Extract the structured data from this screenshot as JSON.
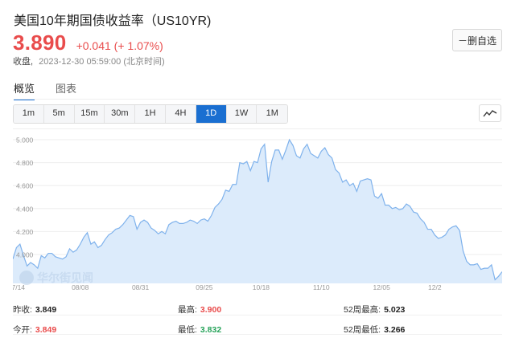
{
  "header": {
    "title": "美国10年期国债收益率（US10YR)",
    "price": "3.890",
    "change": "+0.041 (+ 1.07%)",
    "status_label": "收盘,",
    "status_time": "2023-12-30 05:59:00 (北京时间)",
    "fav_label": "－删自选"
  },
  "tabs": [
    {
      "label": "概览",
      "active": true
    },
    {
      "label": "图表",
      "active": false
    }
  ],
  "periods": [
    {
      "label": "1m"
    },
    {
      "label": "5m"
    },
    {
      "label": "15m"
    },
    {
      "label": "30m"
    },
    {
      "label": "1H"
    },
    {
      "label": "4H"
    },
    {
      "label": "1D",
      "active": true
    },
    {
      "label": "1W"
    },
    {
      "label": "1M"
    }
  ],
  "watermark": "华尔街见闻",
  "chart_data": {
    "type": "area",
    "ylim": [
      3.8,
      5.0
    ],
    "y_ticks": [
      "5.000",
      "4.800",
      "4.600",
      "4.400",
      "4.200",
      "4.000"
    ],
    "x_ticks": [
      {
        "label": "07/14",
        "i": 1
      },
      {
        "label": "08/08",
        "i": 19
      },
      {
        "label": "08/31",
        "i": 36
      },
      {
        "label": "09/25",
        "i": 54
      },
      {
        "label": "10/18",
        "i": 70
      },
      {
        "label": "11/10",
        "i": 87
      },
      {
        "label": "12/05",
        "i": 104
      },
      {
        "label": "12/2",
        "i": 119
      }
    ],
    "series": [
      {
        "color": "#7fb2ec",
        "fill": "#dcebfb",
        "values": [
          3.96,
          4.06,
          4.09,
          3.99,
          3.9,
          3.93,
          3.91,
          3.88,
          3.99,
          3.97,
          4.01,
          4.01,
          3.98,
          3.97,
          3.96,
          3.98,
          4.05,
          4.02,
          4.04,
          4.09,
          4.15,
          4.19,
          4.09,
          4.11,
          4.06,
          4.08,
          4.13,
          4.17,
          4.19,
          4.22,
          4.23,
          4.26,
          4.3,
          4.34,
          4.33,
          4.22,
          4.28,
          4.3,
          4.28,
          4.23,
          4.21,
          4.18,
          4.2,
          4.18,
          4.26,
          4.28,
          4.29,
          4.27,
          4.27,
          4.28,
          4.3,
          4.29,
          4.27,
          4.3,
          4.31,
          4.29,
          4.34,
          4.41,
          4.44,
          4.48,
          4.56,
          4.55,
          4.61,
          4.61,
          4.8,
          4.79,
          4.81,
          4.73,
          4.81,
          4.8,
          4.92,
          4.96,
          4.63,
          4.81,
          4.91,
          4.91,
          4.83,
          4.91,
          5.0,
          4.95,
          4.86,
          4.84,
          4.92,
          4.96,
          4.88,
          4.86,
          4.84,
          4.9,
          4.93,
          4.87,
          4.84,
          4.74,
          4.71,
          4.63,
          4.65,
          4.6,
          4.62,
          4.55,
          4.64,
          4.65,
          4.66,
          4.65,
          4.51,
          4.49,
          4.53,
          4.43,
          4.43,
          4.4,
          4.41,
          4.39,
          4.4,
          4.44,
          4.42,
          4.37,
          4.36,
          4.31,
          4.28,
          4.22,
          4.22,
          4.17,
          4.14,
          4.15,
          4.17,
          4.22,
          4.24,
          4.25,
          4.21,
          4.03,
          3.94,
          3.91,
          3.91,
          3.92,
          3.87,
          3.88,
          3.88,
          3.91,
          3.78,
          3.81,
          3.85
        ]
      }
    ]
  },
  "stats": {
    "prev_close_label": "昨收:",
    "prev_close": "3.849",
    "high_label": "最高:",
    "high": "3.900",
    "wk52_high_label": "52周最高:",
    "wk52_high": "5.023",
    "open_label": "今开:",
    "open": "3.849",
    "low_label": "最低:",
    "low": "3.832",
    "wk52_low_label": "52周最低:",
    "wk52_low": "3.266"
  }
}
